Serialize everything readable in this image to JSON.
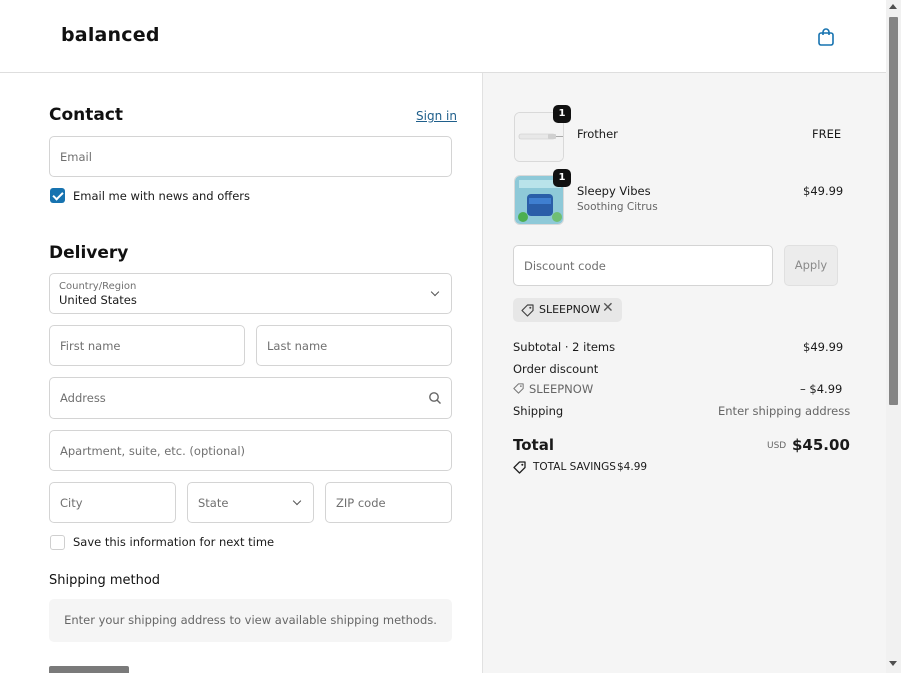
{
  "header": {
    "logo": "balanced",
    "cart_icon": "shopping-bag-icon"
  },
  "contact": {
    "title": "Contact",
    "sign_in": "Sign in",
    "email_placeholder": "Email",
    "newsletter_label": "Email me with news and offers",
    "newsletter_checked": true
  },
  "delivery": {
    "title": "Delivery",
    "country_label": "Country/Region",
    "country_value": "United States",
    "first_name_placeholder": "First name",
    "last_name_placeholder": "Last name",
    "address_placeholder": "Address",
    "apartment_placeholder": "Apartment, suite, etc. (optional)",
    "city_placeholder": "City",
    "state_placeholder": "State",
    "zip_placeholder": "ZIP code",
    "save_info_label": "Save this information for next time",
    "save_info_checked": false
  },
  "shipping_method": {
    "title": "Shipping method",
    "notice": "Enter your shipping address to view available shipping methods."
  },
  "summary": {
    "items": [
      {
        "name": "Frother",
        "variant": "",
        "qty": "1",
        "price": "FREE"
      },
      {
        "name": "Sleepy Vibes",
        "variant": "Soothing Citrus",
        "qty": "1",
        "price": "$49.99"
      }
    ],
    "discount_placeholder": "Discount code",
    "apply_label": "Apply",
    "applied_code": "SLEEPNOW",
    "subtotal_label": "Subtotal · 2 items",
    "subtotal_value": "$49.99",
    "order_discount_label": "Order discount",
    "discount_code": "SLEEPNOW",
    "discount_value": "– $4.99",
    "shipping_label": "Shipping",
    "shipping_value": "Enter shipping address",
    "total_label": "Total",
    "currency": "USD",
    "total_value": "$45.00",
    "savings_label": "TOTAL SAVINGS",
    "savings_value": "$4.99"
  },
  "colors": {
    "accent": "#1773b0",
    "link": "#1f5f8b",
    "panel": "#f5f5f5"
  }
}
